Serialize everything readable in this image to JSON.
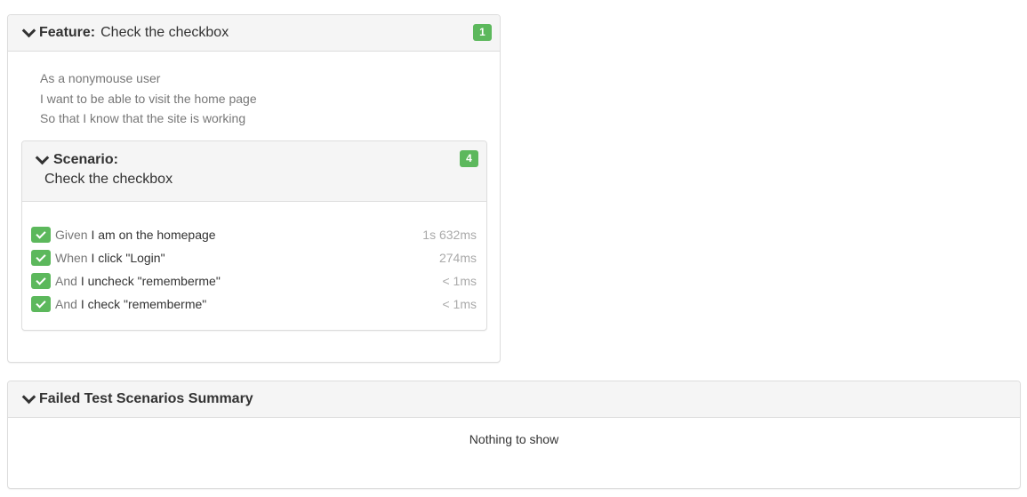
{
  "feature": {
    "label": "Feature:",
    "name": "Check the checkbox",
    "badge": "1",
    "description": [
      "As a nonymouse user",
      "I want to be able to visit the home page",
      "So that I know that the site is working"
    ],
    "scenario": {
      "label": "Scenario:",
      "name": "Check the checkbox",
      "badge": "4",
      "steps": [
        {
          "keyword": "Given",
          "text": "I am on the homepage",
          "duration": "1s 632ms",
          "status": "passed"
        },
        {
          "keyword": "When",
          "text": "I click \"Login\"",
          "duration": "274ms",
          "status": "passed"
        },
        {
          "keyword": "And",
          "text": "I uncheck \"rememberme\"",
          "duration": "< 1ms",
          "status": "passed"
        },
        {
          "keyword": "And",
          "text": "I check \"rememberme\"",
          "duration": "< 1ms",
          "status": "passed"
        }
      ]
    }
  },
  "summary": {
    "title": "Failed Test Scenarios Summary",
    "empty_message": "Nothing to show"
  },
  "colors": {
    "passed": "#5cb85c",
    "heading_bg": "#f5f5f5",
    "border": "#dddddd"
  },
  "icons": {
    "collapse": "chevron-down-icon",
    "step_status": "check-icon"
  }
}
